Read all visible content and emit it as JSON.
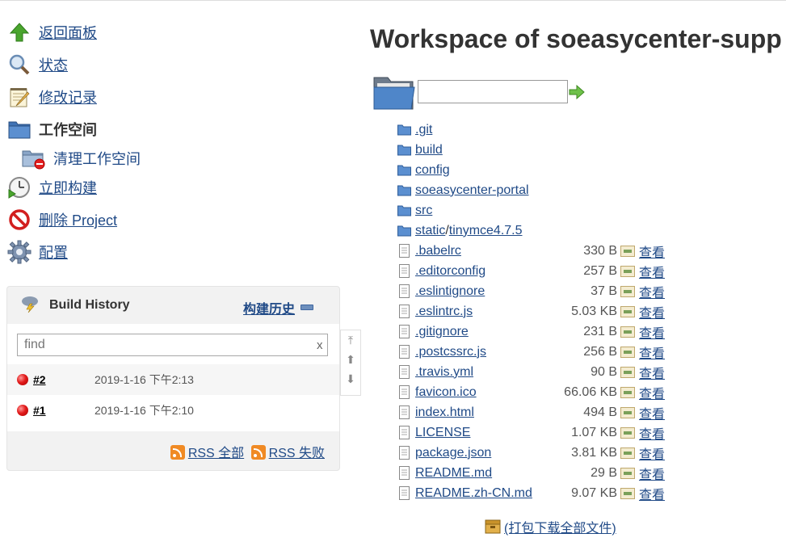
{
  "nav": {
    "back": "返回面板",
    "status": "状态",
    "changes": "修改记录",
    "workspace": "工作空间",
    "wipe_workspace": "清理工作空间",
    "build_now": "立即构建",
    "delete_project": "删除 Project",
    "configure": "配置"
  },
  "build_history": {
    "title": "Build History",
    "trend_link": "构建历史",
    "search_placeholder": "find",
    "clear": "x",
    "builds": [
      {
        "number": "#2",
        "time": "2019-1-16 下午2:13",
        "status": "failed"
      },
      {
        "number": "#1",
        "time": "2019-1-16 下午2:10",
        "status": "failed"
      }
    ],
    "rss_all": "RSS 全部",
    "rss_failed": "RSS 失败"
  },
  "page": {
    "title": "Workspace of soeasycenter-supp",
    "path_input_value": ""
  },
  "folders": [
    {
      "name": ".git"
    },
    {
      "name": "build"
    },
    {
      "name": "config"
    },
    {
      "name": "soeasycenter-portal"
    },
    {
      "name": "src"
    },
    {
      "name": "static",
      "sub": "tinymce4.7.5",
      "separator": "/"
    }
  ],
  "files": [
    {
      "name": ".babelrc",
      "size": "330 B",
      "view": "查看"
    },
    {
      "name": ".editorconfig",
      "size": "257 B",
      "view": "查看"
    },
    {
      "name": ".eslintignore",
      "size": "37 B",
      "view": "查看"
    },
    {
      "name": ".eslintrc.js",
      "size": "5.03 KB",
      "view": "查看"
    },
    {
      "name": ".gitignore",
      "size": "231 B",
      "view": "查看"
    },
    {
      "name": ".postcssrc.js",
      "size": "256 B",
      "view": "查看"
    },
    {
      "name": ".travis.yml",
      "size": "90 B",
      "view": "查看"
    },
    {
      "name": "favicon.ico",
      "size": "66.06 KB",
      "view": "查看"
    },
    {
      "name": "index.html",
      "size": "494 B",
      "view": "查看"
    },
    {
      "name": "LICENSE",
      "size": "1.07 KB",
      "view": "查看"
    },
    {
      "name": "package.json",
      "size": "3.81 KB",
      "view": "查看"
    },
    {
      "name": "README.md",
      "size": "29 B",
      "view": "查看"
    },
    {
      "name": "README.zh-CN.md",
      "size": "9.07 KB",
      "view": "查看"
    }
  ],
  "download_all": "(打包下载全部文件)",
  "colors": {
    "link": "#204A87",
    "folder": "#5b8fd0",
    "failed": "#e21b1b",
    "panel_bg": "#f2f2f2"
  }
}
